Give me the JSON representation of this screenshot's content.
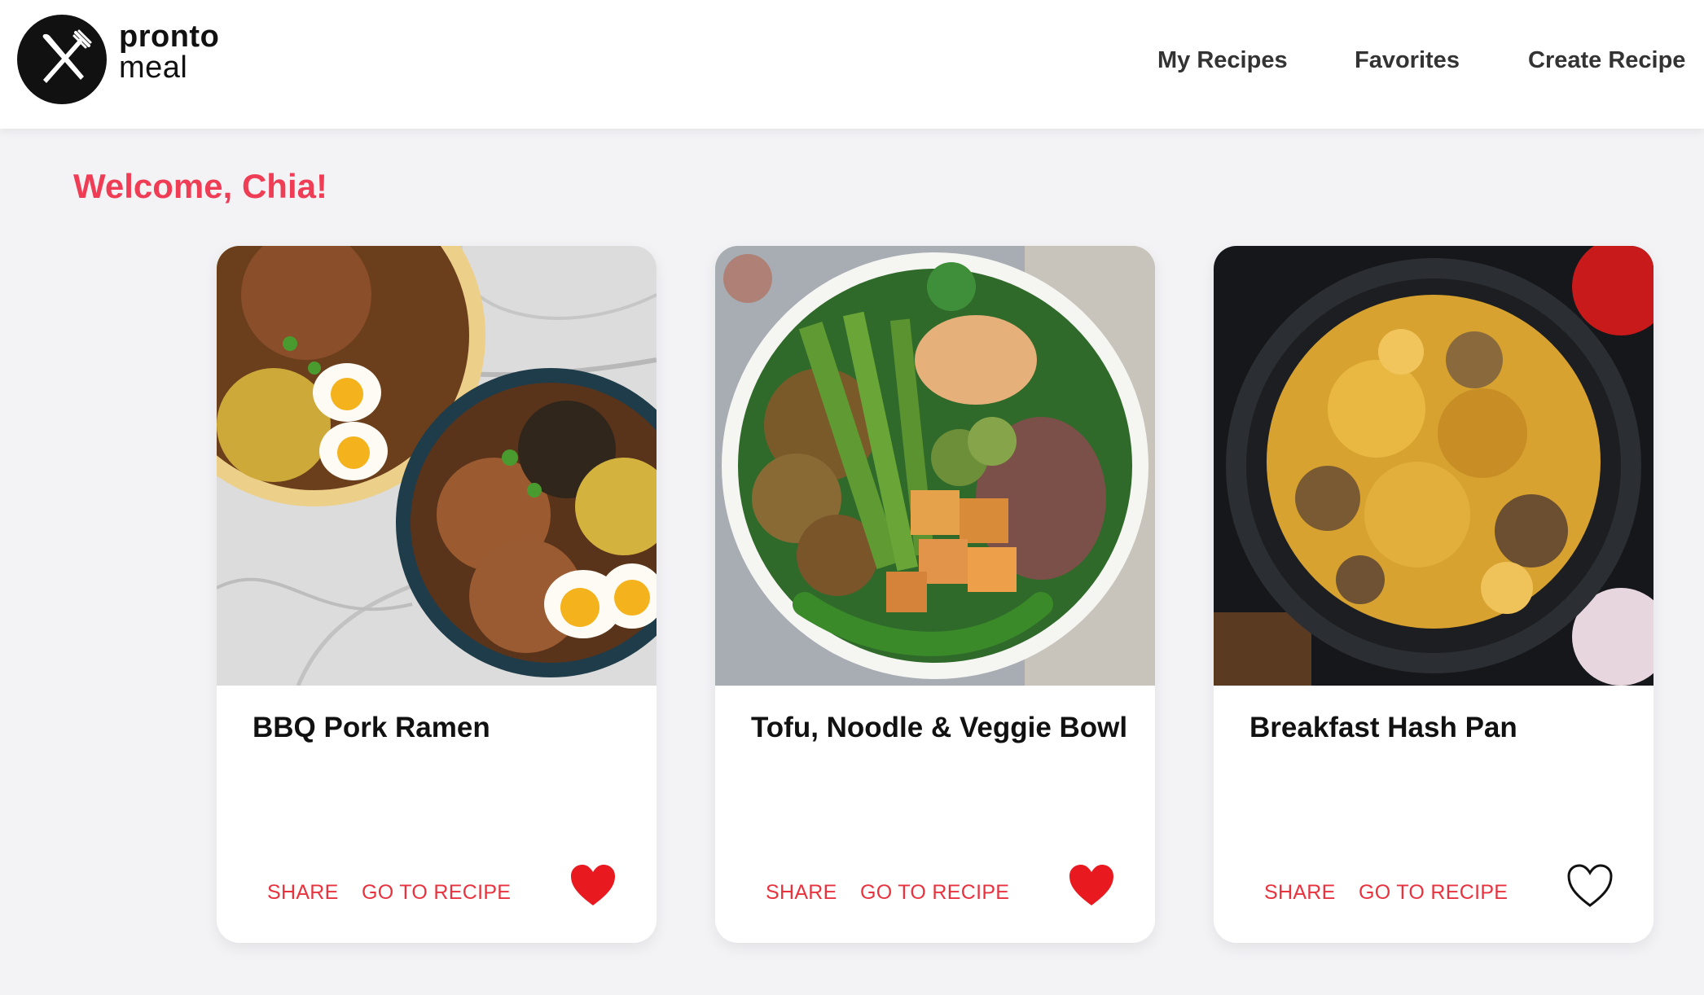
{
  "brand": {
    "name_line1": "pronto",
    "name_line2": "meal",
    "logo_icon": "fork-knife-crossed-icon"
  },
  "nav": {
    "items": [
      "My Recipes",
      "Favorites",
      "Create Recipe"
    ]
  },
  "welcome": "Welcome, Chia!",
  "colors": {
    "accent": "#ef3d55",
    "action": "#e8333f",
    "heart_filled": "#e8191f",
    "background": "#f3f3f6"
  },
  "recipes": [
    {
      "title": "BBQ Pork Ramen",
      "share": "SHARE",
      "go": "GO TO RECIPE",
      "favorite": true,
      "image": "ramen-photo"
    },
    {
      "title": "Tofu, Noodle & Veggie Bowl",
      "share": "SHARE",
      "go": "GO TO RECIPE",
      "favorite": true,
      "image": "veggie-bowl-photo"
    },
    {
      "title": "Breakfast Hash Pan",
      "share": "SHARE",
      "go": "GO TO RECIPE",
      "favorite": false,
      "image": "hash-pan-photo"
    }
  ]
}
